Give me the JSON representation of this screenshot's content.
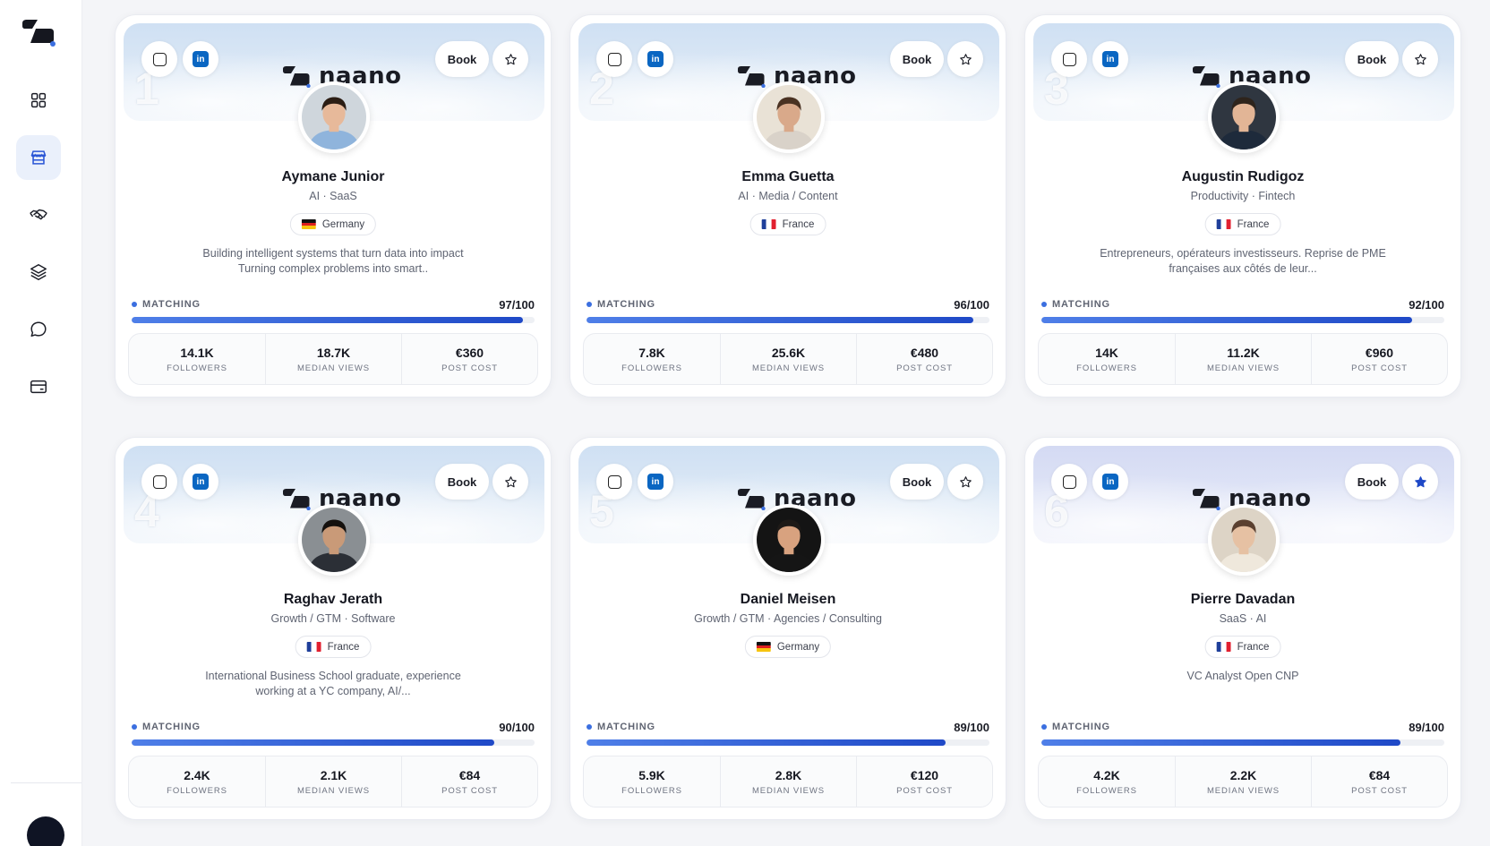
{
  "app": {
    "nav": [
      {
        "icon": "dashboard-grid-icon",
        "active": false
      },
      {
        "icon": "marketplace-store-icon",
        "active": true
      },
      {
        "icon": "handshake-icon",
        "active": false
      },
      {
        "icon": "layers-icon",
        "active": false
      },
      {
        "icon": "chat-bubble-icon",
        "active": false
      },
      {
        "icon": "card-wallet-icon",
        "active": false
      }
    ]
  },
  "labels": {
    "book": "Book",
    "matching": "MATCHING",
    "followers": "FOLLOWERS",
    "median_views": "MEDIAN VIEWS",
    "post_cost": "POST COST",
    "brand": "naano",
    "linkedin": "in"
  },
  "colors": {
    "accent": "#1f49c7",
    "linkedin": "#0a66c2",
    "active_nav_bg": "#eaf0fb"
  },
  "creators": [
    {
      "rank": "1",
      "name": "Aymane Junior",
      "niche": "AI · SaaS",
      "country": "Germany",
      "flag": "de",
      "bio": "Building intelligent systems that turn data into impact Turning complex problems into smart..",
      "score_text": "97/100",
      "score": 97,
      "followers": "14.1K",
      "median_views": "18.7K",
      "post_cost": "€360",
      "starred": false
    },
    {
      "rank": "2",
      "name": "Emma Guetta",
      "niche": "AI · Media / Content",
      "country": "France",
      "flag": "fr",
      "bio": "",
      "score_text": "96/100",
      "score": 96,
      "followers": "7.8K",
      "median_views": "25.6K",
      "post_cost": "€480",
      "starred": false
    },
    {
      "rank": "3",
      "name": "Augustin Rudigoz",
      "niche": "Productivity · Fintech",
      "country": "France",
      "flag": "fr",
      "bio": "Entrepreneurs, opérateurs investisseurs. Reprise de PME françaises aux côtés de leur...",
      "score_text": "92/100",
      "score": 92,
      "followers": "14K",
      "median_views": "11.2K",
      "post_cost": "€960",
      "starred": false
    },
    {
      "rank": "4",
      "name": "Raghav Jerath",
      "niche": "Growth / GTM · Software",
      "country": "France",
      "flag": "fr",
      "bio": "International Business School graduate, experience working at a YC company, AI/...",
      "score_text": "90/100",
      "score": 90,
      "followers": "2.4K",
      "median_views": "2.1K",
      "post_cost": "€84",
      "starred": false
    },
    {
      "rank": "5",
      "name": "Daniel Meisen",
      "niche": "Growth / GTM · Agencies / Consulting",
      "country": "Germany",
      "flag": "de",
      "bio": "",
      "score_text": "89/100",
      "score": 89,
      "followers": "5.9K",
      "median_views": "2.8K",
      "post_cost": "€120",
      "starred": false
    },
    {
      "rank": "6",
      "name": "Pierre Davadan",
      "niche": "SaaS · AI",
      "country": "France",
      "flag": "fr",
      "bio": "VC Analyst Open CNP",
      "score_text": "89/100",
      "score": 89,
      "followers": "4.2K",
      "median_views": "2.2K",
      "post_cost": "€84",
      "starred": true
    }
  ]
}
